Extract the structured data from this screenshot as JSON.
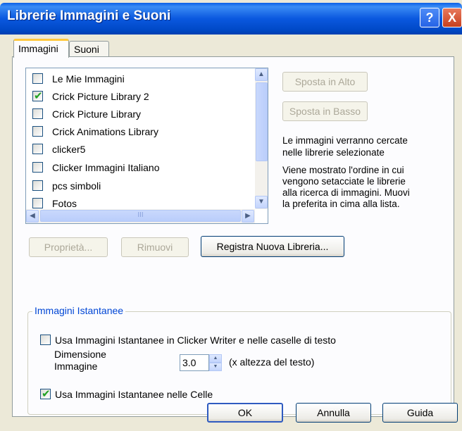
{
  "window": {
    "title": "Librerie Immagini e Suoni"
  },
  "titlebar": {
    "help_glyph": "?",
    "close_glyph": "X",
    "help_icon": "help-icon",
    "close_icon": "close-icon"
  },
  "tabs": [
    {
      "label": "Immagini",
      "selected": true
    },
    {
      "label": "Suoni",
      "selected": false
    }
  ],
  "libraries": [
    {
      "label": "Le Mie Immagini",
      "checked": false
    },
    {
      "label": "Crick Picture Library 2",
      "checked": true
    },
    {
      "label": "Crick Picture Library",
      "checked": false
    },
    {
      "label": "Crick Animations Library",
      "checked": false
    },
    {
      "label": "clicker5",
      "checked": false
    },
    {
      "label": "Clicker Immagini Italiano",
      "checked": false
    },
    {
      "label": "pcs simboli",
      "checked": false
    },
    {
      "label": "Fotos",
      "checked": false
    }
  ],
  "buttons": {
    "move_up": "Sposta in Alto",
    "move_down": "Sposta in Basso",
    "properties": "Proprietà...",
    "remove": "Rimuovi",
    "register": "Registra Nuova Libreria...",
    "ok": "OK",
    "cancel": "Annulla",
    "help": "Guida"
  },
  "info": {
    "line1a": "Le immagini verranno cercate",
    "line1b": "nelle librerie selezionate",
    "line2a": "Viene mostrato l'ordine in cui",
    "line2b": "vengono setacciate le librerie",
    "line2c": "alla ricerca di immagini. Muovi",
    "line2d": "la preferita in cima alla lista."
  },
  "instant": {
    "group_title": "Immagini Istantanee",
    "use_in_writer": "Usa Immagini Istantanee in Clicker Writer e nelle caselle di testo",
    "use_in_writer_checked": false,
    "size_label_1": "Dimensione",
    "size_label_2": "Immagine",
    "size_value": "3.0",
    "size_unit": "(x altezza del testo)",
    "use_in_cells": "Usa Immagini Istantanee nelle Celle",
    "use_in_cells_checked": true
  },
  "glyphs": {
    "check": "✔",
    "up": "▲",
    "down": "▼",
    "left": "◀",
    "right": "▶",
    "grip": "III"
  }
}
